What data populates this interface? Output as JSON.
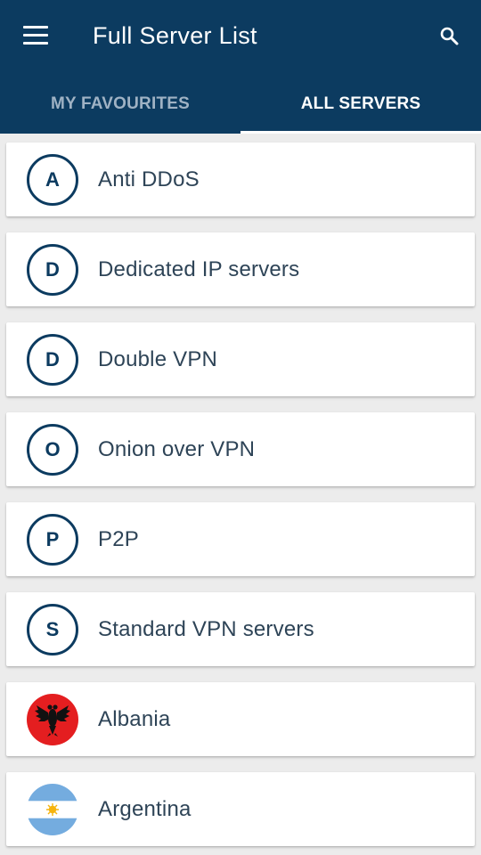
{
  "header": {
    "title": "Full Server List",
    "background_color": "#0c3b60",
    "menu_icon": "hamburger-menu-icon",
    "search_icon": "search-icon"
  },
  "tabs": [
    {
      "label": "MY FAVOURITES",
      "selected": false
    },
    {
      "label": "ALL SERVERS",
      "selected": true
    }
  ],
  "servers": [
    {
      "label": "Anti DDoS",
      "badge": "A"
    },
    {
      "label": "Dedicated IP servers",
      "badge": "D"
    },
    {
      "label": "Double VPN",
      "badge": "D"
    },
    {
      "label": "Onion over VPN",
      "badge": "O"
    },
    {
      "label": "P2P",
      "badge": "P"
    },
    {
      "label": "Standard VPN servers",
      "badge": "S"
    },
    {
      "label": "Albania",
      "icon": "albania-flag-icon"
    },
    {
      "label": "Argentina",
      "icon": "argentina-flag-icon"
    }
  ]
}
